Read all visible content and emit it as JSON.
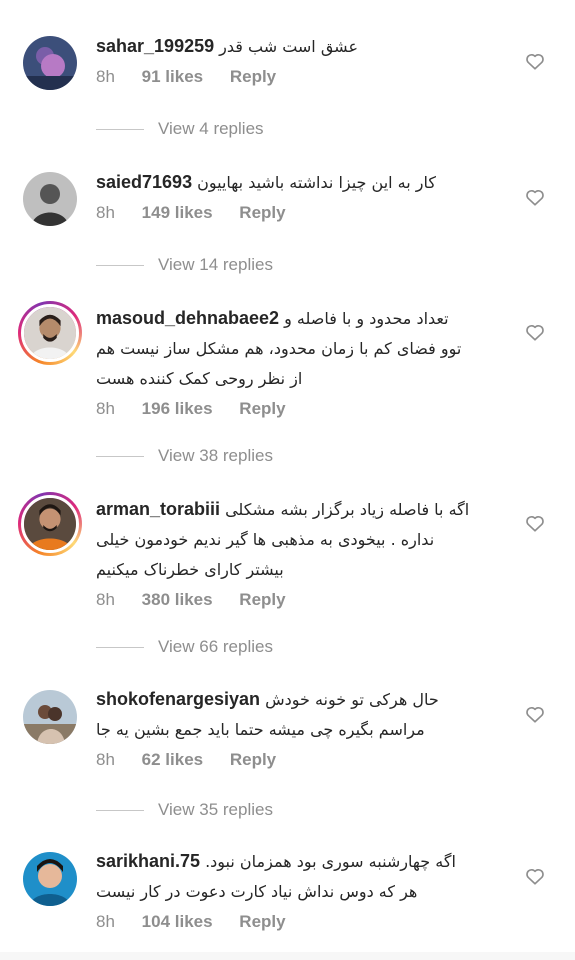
{
  "comments": [
    {
      "username": "sahar_199259",
      "lines": [
        "عشق است شب قدر"
      ],
      "time": "8h",
      "likes": "91 likes",
      "reply": "Reply",
      "view_replies": "View 4 replies",
      "story_ring": false
    },
    {
      "username": "saied71693",
      "lines": [
        "کار به این چیزا نداشته باشید بهاییون"
      ],
      "time": "8h",
      "likes": "149 likes",
      "reply": "Reply",
      "view_replies": "View 14 replies",
      "story_ring": false
    },
    {
      "username": "masoud_dehnabaee2",
      "lines": [
        "تعداد محدود و با فاصله و",
        "توو فضای کم با زمان محدود، هم مشکل ساز نیست هم",
        "از نظر روحی کمک کننده هست"
      ],
      "time": "8h",
      "likes": "196 likes",
      "reply": "Reply",
      "view_replies": "View 38 replies",
      "story_ring": true
    },
    {
      "username": "arman_torabiii",
      "lines": [
        "اگه با فاصله زیاد برگزار بشه مشکلی",
        "نداره . بیخودی به مذهبی ها گیر ندیم خودمون خیلی",
        "بیشتر کارای خطرناک میکنیم"
      ],
      "time": "8h",
      "likes": "380 likes",
      "reply": "Reply",
      "view_replies": "View 66 replies",
      "story_ring": true
    },
    {
      "username": "shokofenargesiyan",
      "lines": [
        "حال هرکی تو خونه خودش",
        "مراسم بگیره چی میشه حتما باید جمع بشین یه جا"
      ],
      "time": "8h",
      "likes": "62 likes",
      "reply": "Reply",
      "view_replies": "View 35 replies",
      "story_ring": false
    },
    {
      "username": "sarikhani.75",
      "lines": [
        "اگه چهارشنبه سوری بود همزمان نبود.",
        "هر که دوس نداش نیاد کارت دعوت در کار نیست"
      ],
      "time": "8h",
      "likes": "104 likes",
      "reply": "Reply",
      "view_replies": null,
      "story_ring": false
    }
  ],
  "icons": {
    "like": "heart-outline-icon",
    "avatar": "user-avatar"
  },
  "colors": {
    "text": "#262626",
    "secondary": "#8e8e8e",
    "divider": "#c7c7c7"
  }
}
